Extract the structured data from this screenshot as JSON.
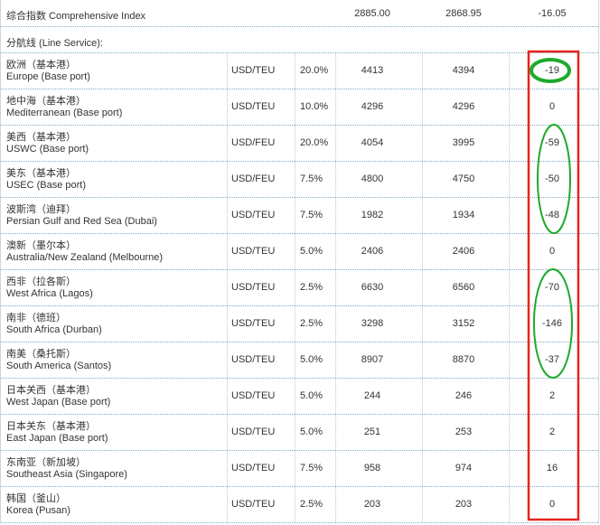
{
  "header": {
    "title": "综合指数 Comprehensive Index",
    "prev": "2885.00",
    "curr": "2868.95",
    "change": "-16.05"
  },
  "section_label": "分航线 (Line Service):",
  "rows": [
    {
      "cn": "欧洲（基本港）",
      "en": "Europe (Base port)",
      "unit": "USD/TEU",
      "weight": "20.0%",
      "prev": "4413",
      "curr": "4394",
      "change": "-19"
    },
    {
      "cn": "地中海（基本港）",
      "en": "Mediterranean (Base port)",
      "unit": "USD/TEU",
      "weight": "10.0%",
      "prev": "4296",
      "curr": "4296",
      "change": "0"
    },
    {
      "cn": "美西（基本港）",
      "en": "USWC (Base port)",
      "unit": "USD/FEU",
      "weight": "20.0%",
      "prev": "4054",
      "curr": "3995",
      "change": "-59"
    },
    {
      "cn": "美东（基本港）",
      "en": "USEC (Base port)",
      "unit": "USD/FEU",
      "weight": "7.5%",
      "prev": "4800",
      "curr": "4750",
      "change": "-50"
    },
    {
      "cn": "波斯湾（迪拜）",
      "en": "Persian Gulf and Red Sea (Dubai)",
      "unit": "USD/TEU",
      "weight": "7.5%",
      "prev": "1982",
      "curr": "1934",
      "change": "-48"
    },
    {
      "cn": "澳新（墨尔本）",
      "en": "Australia/New Zealand (Melbourne)",
      "unit": "USD/TEU",
      "weight": "5.0%",
      "prev": "2406",
      "curr": "2406",
      "change": "0"
    },
    {
      "cn": "西非（拉各斯）",
      "en": "West Africa (Lagos)",
      "unit": "USD/TEU",
      "weight": "2.5%",
      "prev": "6630",
      "curr": "6560",
      "change": "-70"
    },
    {
      "cn": "南非（德班）",
      "en": "South Africa (Durban)",
      "unit": "USD/TEU",
      "weight": "2.5%",
      "prev": "3298",
      "curr": "3152",
      "change": "-146"
    },
    {
      "cn": "南美（桑托斯）",
      "en": "South America (Santos)",
      "unit": "USD/TEU",
      "weight": "5.0%",
      "prev": "8907",
      "curr": "8870",
      "change": "-37"
    },
    {
      "cn": "日本关西（基本港）",
      "en": "West Japan (Base port)",
      "unit": "USD/TEU",
      "weight": "5.0%",
      "prev": "244",
      "curr": "246",
      "change": "2"
    },
    {
      "cn": "日本关东（基本港）",
      "en": "East Japan (Base port)",
      "unit": "USD/TEU",
      "weight": "5.0%",
      "prev": "251",
      "curr": "253",
      "change": "2"
    },
    {
      "cn": "东南亚（新加坡）",
      "en": "Southeast Asia (Singapore)",
      "unit": "USD/TEU",
      "weight": "7.5%",
      "prev": "958",
      "curr": "974",
      "change": "16"
    },
    {
      "cn": "韩国（釜山）",
      "en": "Korea (Pusan)",
      "unit": "USD/TEU",
      "weight": "2.5%",
      "prev": "203",
      "curr": "203",
      "change": "0"
    }
  ],
  "annotation_colors": {
    "box": "#e8231f",
    "circle": "#1faa2c"
  }
}
